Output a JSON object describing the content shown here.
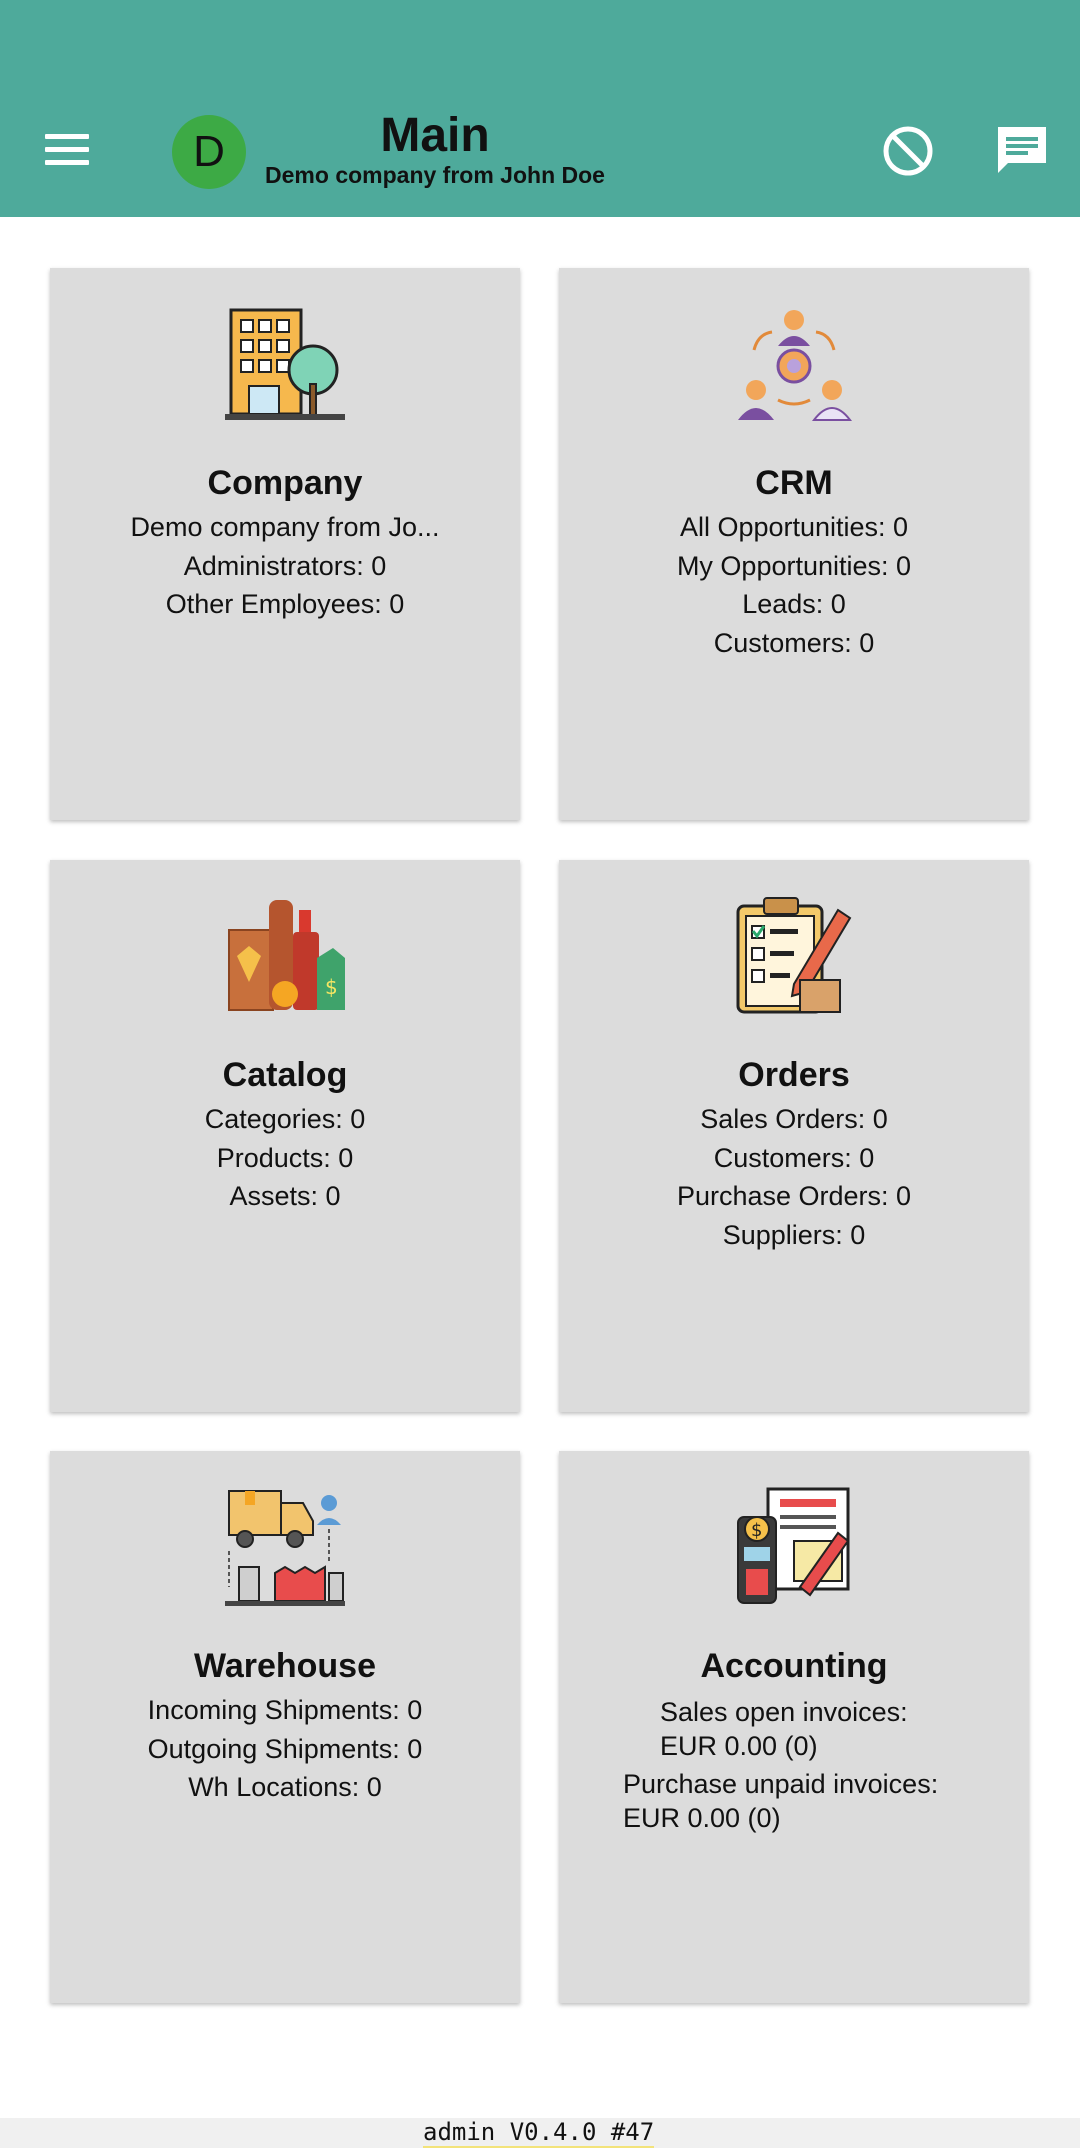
{
  "header": {
    "title": "Main",
    "subtitle": "Demo company from John Doe",
    "avatar_letter": "D",
    "menu_icon": "menu-icon",
    "block_icon": "block-icon",
    "chat_icon": "chat-icon",
    "bar_color": "#4eaa9b",
    "avatar_color": "#3daa45"
  },
  "cards": {
    "company": {
      "title": "Company",
      "lines": [
        "Demo company from Jo...",
        "Administrators: 0",
        "Other Employees: 0"
      ]
    },
    "crm": {
      "title": "CRM",
      "lines": [
        "All Opportunities: 0",
        "My Opportunities: 0",
        "Leads: 0",
        "Customers: 0"
      ]
    },
    "catalog": {
      "title": "Catalog",
      "lines": [
        "Categories: 0",
        "Products: 0",
        "Assets: 0"
      ]
    },
    "orders": {
      "title": "Orders",
      "lines": [
        "Sales Orders: 0",
        "Customers: 0",
        "Purchase Orders: 0",
        "Suppliers: 0"
      ]
    },
    "warehouse": {
      "title": "Warehouse",
      "lines": [
        "Incoming Shipments: 0",
        "Outgoing Shipments: 0",
        "Wh Locations: 0"
      ]
    },
    "accounting": {
      "title": "Accounting",
      "sales_label": "Sales open invoices:",
      "sales_value": "EUR 0.00 (0)",
      "purchase_label": "Purchase unpaid invoices:",
      "purchase_value": "EUR 0.00 (0)"
    }
  },
  "footer": {
    "version": "admin V0.4.0 #47"
  }
}
